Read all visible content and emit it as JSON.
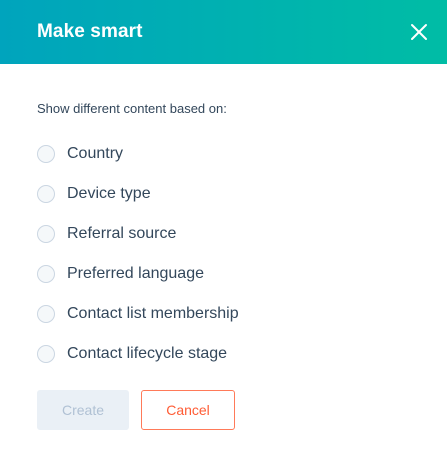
{
  "modal": {
    "title": "Make smart",
    "close_icon": "close-icon",
    "header_gradient": [
      "#00a4bd",
      "#00bda5"
    ]
  },
  "body": {
    "prompt": "Show different content based on:",
    "options": [
      {
        "label": "Country",
        "selected": false
      },
      {
        "label": "Device type",
        "selected": false
      },
      {
        "label": "Referral source",
        "selected": false
      },
      {
        "label": "Preferred language",
        "selected": false
      },
      {
        "label": "Contact list membership",
        "selected": false
      },
      {
        "label": "Contact lifecycle stage",
        "selected": false
      }
    ]
  },
  "footer": {
    "create_label": "Create",
    "create_disabled": true,
    "cancel_label": "Cancel",
    "cancel_color": "#ff7a59"
  }
}
